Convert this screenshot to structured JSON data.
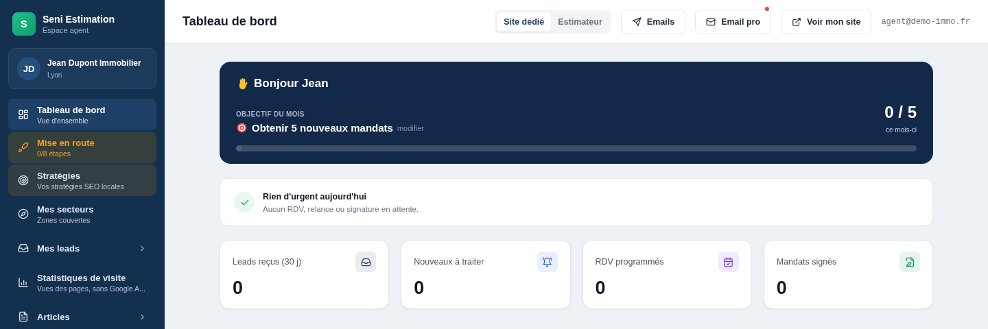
{
  "brand": {
    "logo": "S",
    "name": "Seni Estimation",
    "subtitle": "Espace agent"
  },
  "account": {
    "initials": "JD",
    "name": "Jean Dupont Immobilier",
    "city": "Lyon"
  },
  "sidebar": {
    "items": [
      {
        "label": "Tableau de bord",
        "sub": "Vue d'ensemble",
        "selected": true,
        "kind": "plain",
        "expandable": false
      },
      {
        "label": "Mise en route",
        "sub": "0/8 étapes",
        "selected": false,
        "kind": "warning",
        "expandable": false
      },
      {
        "label": "Stratégies",
        "sub": "Vos stratégies SEO locales",
        "selected": false,
        "kind": "muted",
        "expandable": false
      },
      {
        "label": "Mes secteurs",
        "sub": "Zones couvertes",
        "selected": false,
        "kind": "plain",
        "expandable": false
      },
      {
        "label": "Mes leads",
        "selected": false,
        "kind": "plain",
        "expandable": true
      },
      {
        "label": "Statistiques de visite",
        "sub": "Vues des pages, sans Google A...",
        "selected": false,
        "kind": "plain",
        "expandable": false
      },
      {
        "label": "Articles",
        "selected": false,
        "kind": "plain",
        "expandable": true
      }
    ]
  },
  "header": {
    "title": "Tableau de bord",
    "toggle": [
      {
        "label": "Site dédié",
        "selected": true
      },
      {
        "label": "Estimateur",
        "selected": false
      }
    ],
    "buttons": [
      {
        "label": "Emails",
        "notification": false
      },
      {
        "label": "Email pro",
        "notification": true
      },
      {
        "label": "Voir mon site",
        "notification": false
      }
    ],
    "email": "agent@demo-immo.fr"
  },
  "hero": {
    "greeting": "Bonjour Jean",
    "goal_label": "OBJECTIF DU MOIS",
    "goal": "Obtenir 5 nouveaux mandats",
    "edit_link": "modifier",
    "count": "0 / 5",
    "count_caption": "ce mois-ci",
    "level": 0
  },
  "alert": {
    "title": "Rien d'urgent aujourd'hui",
    "text": "Aucun RDV, relance ou signature en attente."
  },
  "stats": [
    {
      "label": "Leads reçus (30 j)",
      "value": "0",
      "color": "#334155"
    },
    {
      "label": "Nouveaux à traiter",
      "value": "0",
      "color": "#2563eb"
    },
    {
      "label": "RDV programmés",
      "value": "0",
      "color": "#7c3aed"
    },
    {
      "label": "Mandats signés",
      "value": "0",
      "color": "#059669"
    }
  ]
}
